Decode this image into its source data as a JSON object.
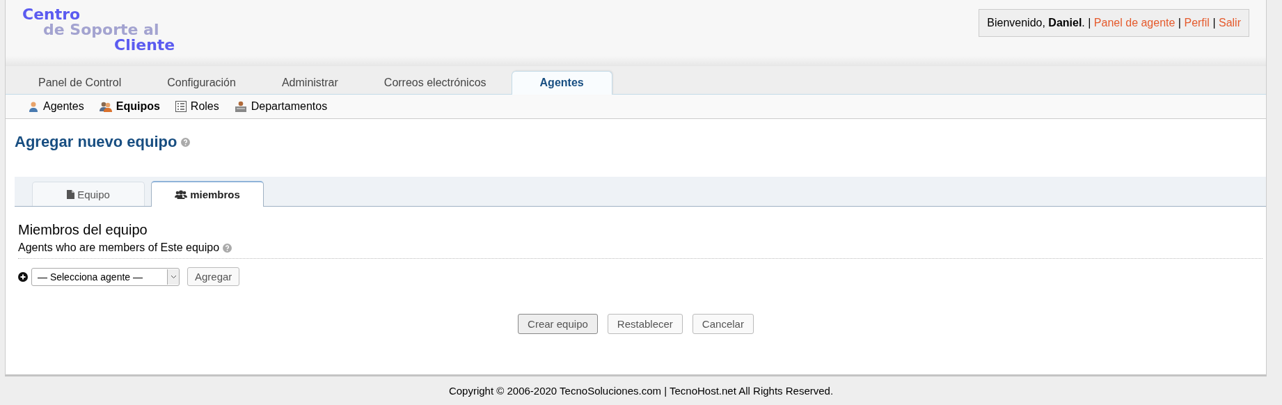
{
  "logo": {
    "lines": [
      "Centro",
      "de Soporte al",
      "Cliente"
    ]
  },
  "welcome": {
    "text": "Bienvenido, **Daniel**.",
    "separator": "|",
    "links": [
      "Panel de agente",
      "Perfil",
      "Salir"
    ]
  },
  "nav_tabs": [
    {
      "label": "Panel de Control",
      "selected": false
    },
    {
      "label": "Configuración",
      "selected": false
    },
    {
      "label": "Administrar",
      "selected": false
    },
    {
      "label": "Correos electrónicos",
      "selected": false
    },
    {
      "label": "Agentes",
      "selected": true
    }
  ],
  "sub_nav": [
    {
      "label": "Agentes",
      "kind": "agent",
      "selected": false
    },
    {
      "label": "Equipos",
      "kind": "team",
      "selected": true
    },
    {
      "label": "Roles",
      "kind": "list",
      "selected": false
    },
    {
      "label": "Departamentos",
      "kind": "desk",
      "selected": false
    }
  ],
  "page_title": "Agregar nuevo equipo",
  "form_tabs": [
    {
      "label": "Equipo",
      "kind": "file",
      "selected": false
    },
    {
      "label": "miembros",
      "kind": "users",
      "selected": true
    }
  ],
  "section": {
    "title": "Miembros del equipo",
    "subtitle": "Agents who are members of Este equipo"
  },
  "agent_select": {
    "value": "— Selecciona agente —"
  },
  "add_button": "Agregar",
  "actions": [
    {
      "label": "Crear equipo",
      "kind": "default"
    },
    {
      "label": "Restablecer",
      "kind": "normal"
    },
    {
      "label": "Cancelar",
      "kind": "normal"
    }
  ],
  "footer": "Copyright © 2006-2020 TecnoSoluciones.com | TecnoHost.net All Rights Reserved."
}
